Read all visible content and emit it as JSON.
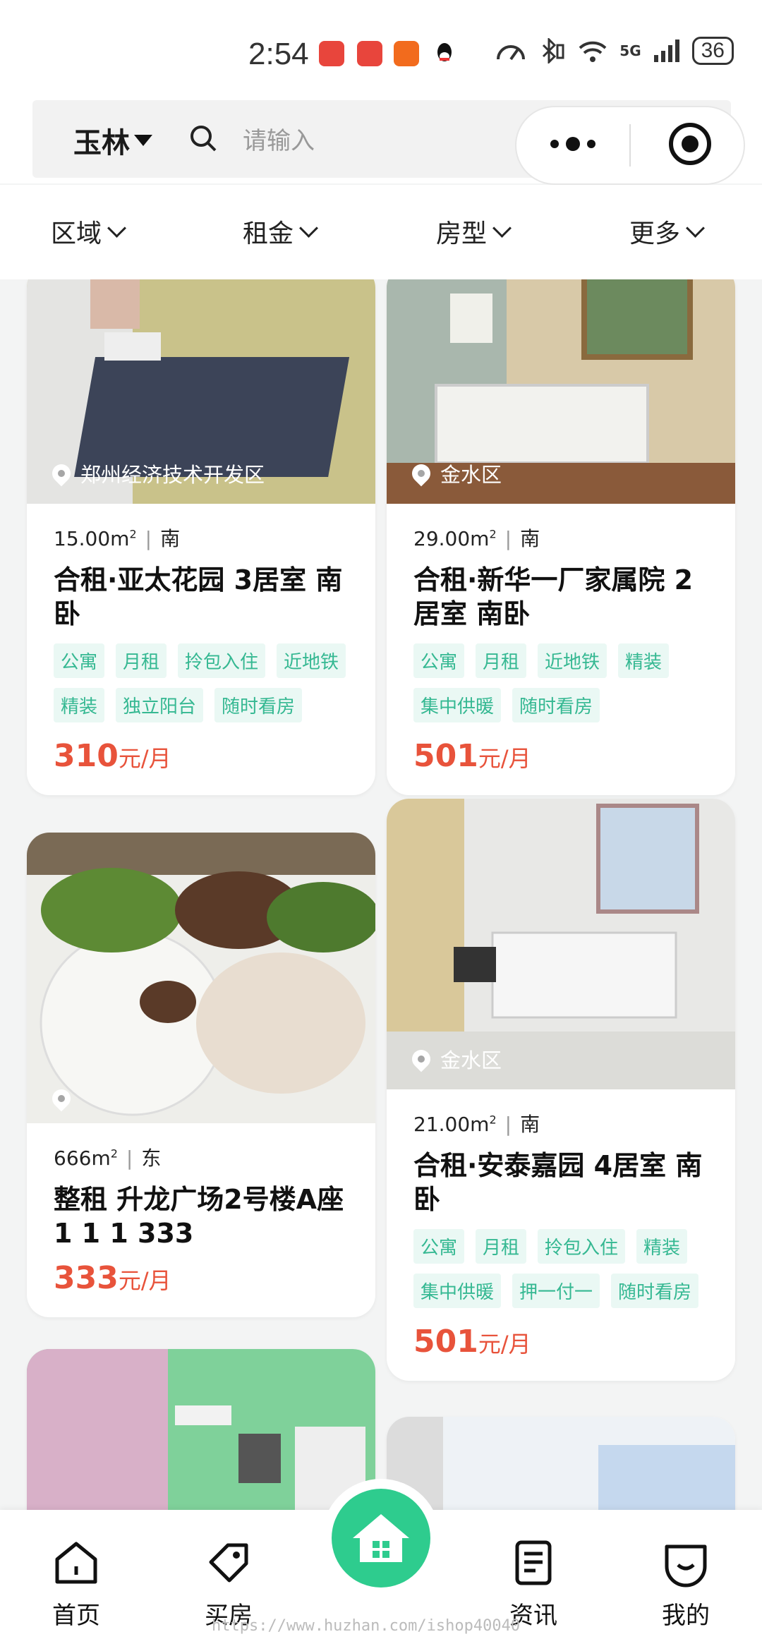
{
  "status_bar": {
    "time": "2:54",
    "battery": "36",
    "network": "5G"
  },
  "header": {
    "city": "玉林",
    "search_placeholder": "请输入"
  },
  "filters": [
    "区域",
    "租金",
    "房型",
    "更多"
  ],
  "listings": [
    {
      "location": "郑州经济技术开发区",
      "area": "15.00m",
      "direction": "南",
      "title": "合租·亚太花园 3居室 南卧",
      "tags": [
        "公寓",
        "月租",
        "拎包入住",
        "近地铁",
        "精装",
        "独立阳台",
        "随时看房"
      ],
      "price": "310",
      "unit": "元/月"
    },
    {
      "location": "金水区",
      "area": "29.00m",
      "direction": "南",
      "title": "合租·新华一厂家属院 2居室 南卧",
      "tags": [
        "公寓",
        "月租",
        "近地铁",
        "精装",
        "集中供暖",
        "随时看房"
      ],
      "price": "501",
      "unit": "元/月"
    },
    {
      "location": "",
      "area": "666m",
      "direction": "东",
      "title": "整租 升龙广场2号楼A座 1 1 1 333",
      "tags": [],
      "price": "333",
      "unit": "元/月"
    },
    {
      "location": "金水区",
      "area": "21.00m",
      "direction": "南",
      "title": "合租·安泰嘉园 4居室 南卧",
      "tags": [
        "公寓",
        "月租",
        "拎包入住",
        "精装",
        "集中供暖",
        "押一付一",
        "随时看房"
      ],
      "price": "501",
      "unit": "元/月"
    }
  ],
  "area_unit_sup": "2",
  "bottom_nav": [
    "首页",
    "买房",
    "资讯",
    "我的"
  ],
  "watermark": "https://www.huzhan.com/ishop40040",
  "colors": {
    "accent": "#2ecc8e",
    "price": "#e8533b",
    "tag_text": "#35b892",
    "tag_bg": "#eaf8f4"
  }
}
